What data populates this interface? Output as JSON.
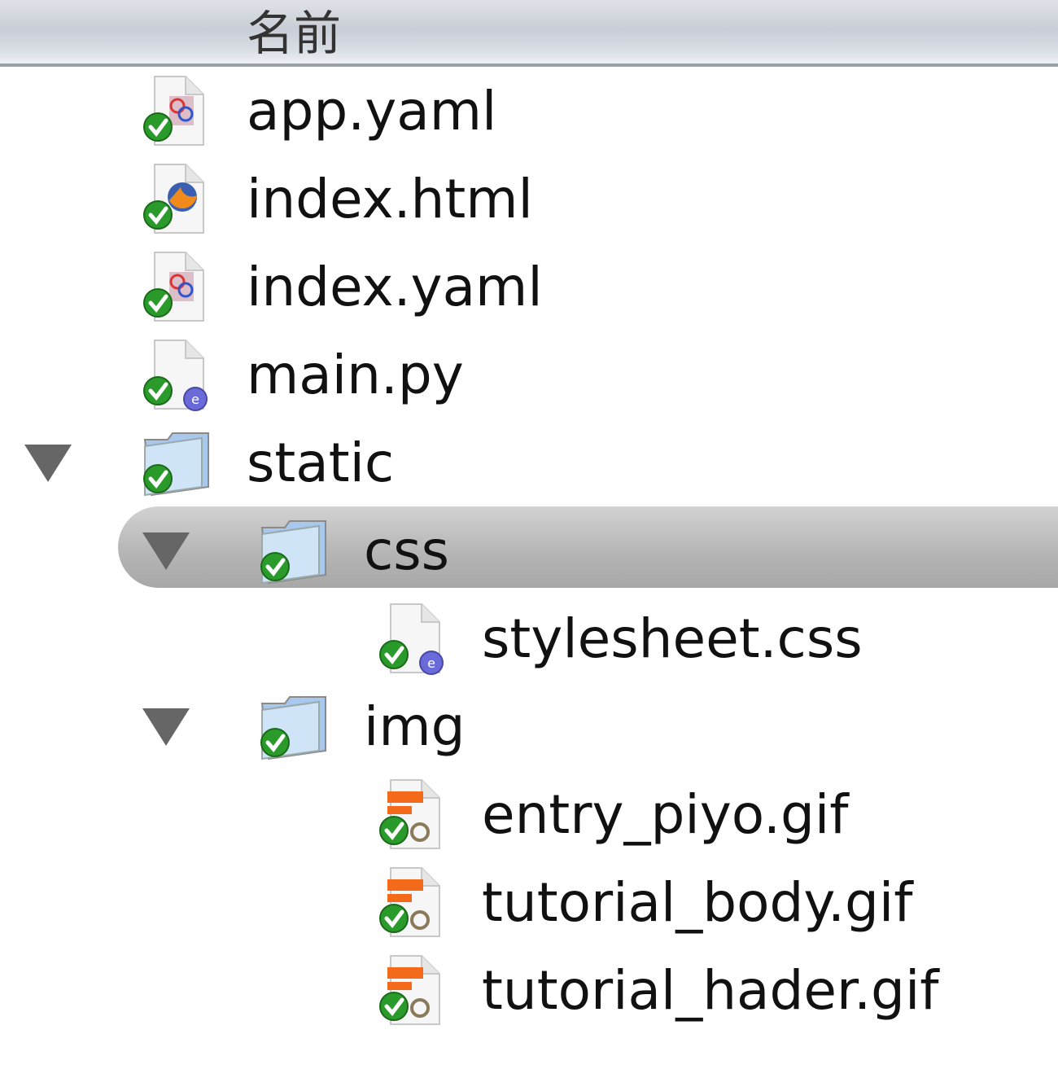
{
  "header": {
    "name_column": "名前"
  },
  "rows": [
    {
      "name": "app.yaml",
      "level": 0,
      "kind": "yaml",
      "expandable": false
    },
    {
      "name": "index.html",
      "level": 0,
      "kind": "html",
      "expandable": false
    },
    {
      "name": "index.yaml",
      "level": 0,
      "kind": "yaml",
      "expandable": false
    },
    {
      "name": "main.py",
      "level": 0,
      "kind": "script",
      "expandable": false
    },
    {
      "name": "static",
      "level": 0,
      "kind": "folder",
      "expandable": true,
      "expanded": true
    },
    {
      "name": "css",
      "level": 1,
      "kind": "folder",
      "expandable": true,
      "expanded": true,
      "selected": true
    },
    {
      "name": "stylesheet.css",
      "level": 2,
      "kind": "script",
      "expandable": false
    },
    {
      "name": "img",
      "level": 1,
      "kind": "folder",
      "expandable": true,
      "expanded": true
    },
    {
      "name": "entry_piyo.gif",
      "level": 2,
      "kind": "image",
      "expandable": false
    },
    {
      "name": "tutorial_body.gif",
      "level": 2,
      "kind": "image",
      "expandable": false
    },
    {
      "name": "tutorial_hader.gif",
      "level": 2,
      "kind": "image",
      "expandable": false
    }
  ],
  "status_badge": "version-control-ok"
}
